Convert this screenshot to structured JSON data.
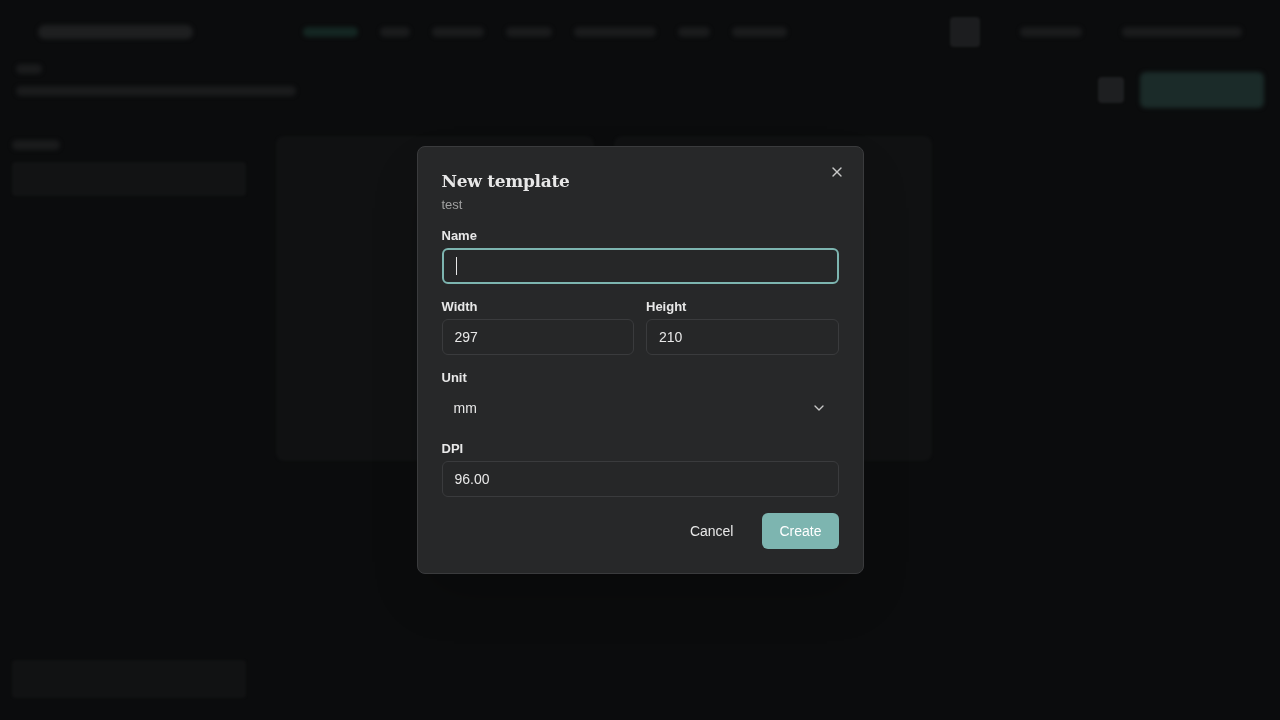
{
  "dialog": {
    "title": "New template",
    "subtitle": "test",
    "fields": [
      {
        "label": "Name",
        "focused": true
      },
      {
        "label": "Width",
        "value": "297",
        "focused": false
      },
      {
        "label": "Height",
        "value": "210",
        "focused": false
      }
    ],
    "unit": {
      "label": "Unit",
      "value": "mm"
    },
    "dpi": {
      "label": "DPI",
      "value": "96.00",
      "focused": false
    },
    "buttons": [
      {
        "label": "Cancel",
        "kind": "ghost"
      },
      {
        "label": "Create",
        "kind": "primary"
      }
    ]
  }
}
